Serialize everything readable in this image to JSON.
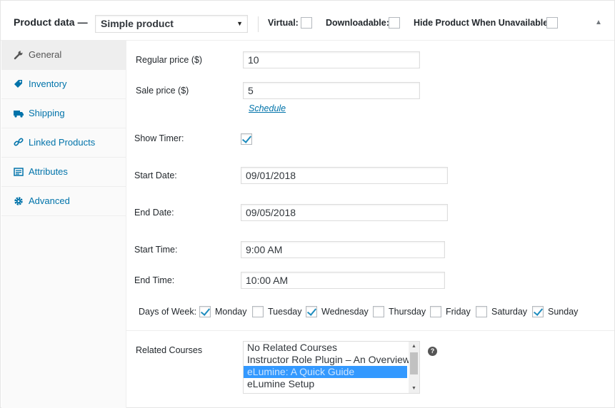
{
  "header": {
    "title": "Product data",
    "dash": "—",
    "product_type": "Simple product",
    "virtual_label": "Virtual:",
    "downloadable_label": "Downloadable:",
    "hide_label": "Hide Product When Unavailable:",
    "collapse_icon": "triangle-up"
  },
  "sidebar": {
    "items": [
      {
        "label": "General",
        "icon": "wrench-icon"
      },
      {
        "label": "Inventory",
        "icon": "tag-icon"
      },
      {
        "label": "Shipping",
        "icon": "truck-icon"
      },
      {
        "label": "Linked Products",
        "icon": "link-icon"
      },
      {
        "label": "Attributes",
        "icon": "list-icon"
      },
      {
        "label": "Advanced",
        "icon": "gear-icon"
      }
    ]
  },
  "general": {
    "regular_price_label": "Regular price ($)",
    "regular_price": "10",
    "sale_price_label": "Sale price ($)",
    "sale_price": "5",
    "schedule_link": "Schedule",
    "show_timer_label": "Show Timer:",
    "show_timer": true,
    "start_date_label": "Start Date:",
    "start_date": "09/01/2018",
    "end_date_label": "End Date:",
    "end_date": "09/05/2018",
    "start_time_label": "Start Time:",
    "start_time": "9:00 AM",
    "end_time_label": "End Time:",
    "end_time": "10:00 AM",
    "days_label": "Days of Week:",
    "days": [
      {
        "label": "Monday",
        "checked": true
      },
      {
        "label": "Tuesday",
        "checked": false
      },
      {
        "label": "Wednesday",
        "checked": true
      },
      {
        "label": "Thursday",
        "checked": false
      },
      {
        "label": "Friday",
        "checked": false
      },
      {
        "label": "Saturday",
        "checked": false
      },
      {
        "label": "Sunday",
        "checked": true
      }
    ],
    "related_courses_label": "Related Courses",
    "related_courses": [
      {
        "label": "No Related Courses",
        "selected": false
      },
      {
        "label": "Instructor Role Plugin – An Overview",
        "selected": false
      },
      {
        "label": "eLumine: A Quick Guide",
        "selected": true
      },
      {
        "label": "eLumine Setup",
        "selected": false
      }
    ],
    "help_icon": "?"
  },
  "colors": {
    "accent": "#0073aa",
    "selection": "#3399ff",
    "check": "#1e8cbe"
  }
}
